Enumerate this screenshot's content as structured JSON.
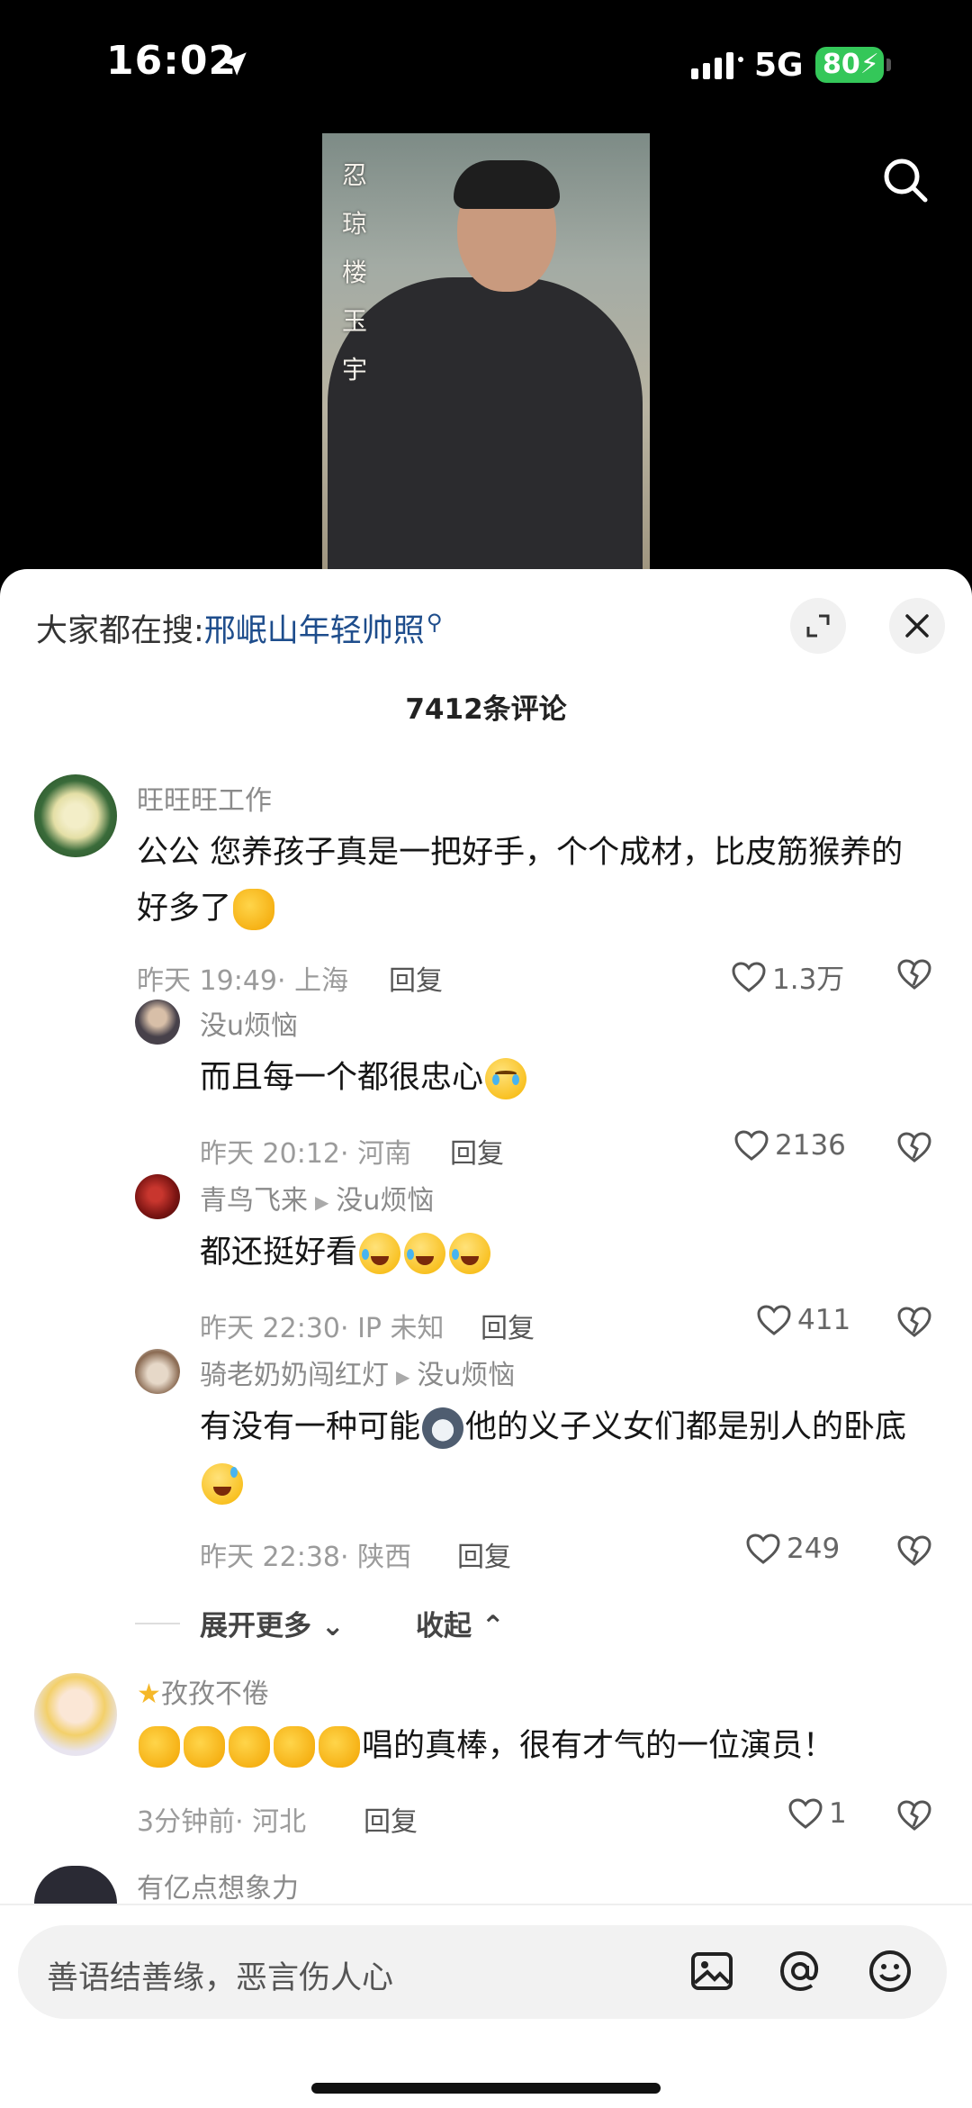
{
  "status_bar": {
    "time": "16:02",
    "network": "5G",
    "battery": "80"
  },
  "video": {
    "overlay_text": "忍 琼 楼 玉 宇"
  },
  "sheet": {
    "hot_search_label": "大家都在搜:",
    "hot_search_keyword": "邢岷山年轻帅照",
    "comment_count": "7412条评论",
    "expand_more": "展开更多",
    "collapse": "收起",
    "input_placeholder": "善语结善缘，恶言伤人心"
  },
  "comments": [
    {
      "name": "旺旺旺工作",
      "text": "公公 您养孩子真是一把好手，个个成材，比皮筋猴养的好多了",
      "time": "昨天 19:49",
      "location": "· 上海",
      "reply": "回复",
      "likes": "1.3万"
    },
    {
      "name": "没u烦恼",
      "text": "而且每一个都很忠心",
      "time": "昨天 20:12",
      "location": "· 河南",
      "reply": "回复",
      "likes": "2136"
    },
    {
      "name": "青鸟飞来",
      "reply_to": "没u烦恼",
      "text": "都还挺好看",
      "time": "昨天 22:30",
      "location": "· IP 未知",
      "reply": "回复",
      "likes": "411"
    },
    {
      "name": "骑老奶奶闯红灯",
      "reply_to": "没u烦恼",
      "text_a": "有没有一种可能",
      "text_b": "他的义子义女们都是别人的卧底",
      "time": "昨天 22:38",
      "location": "· 陕西",
      "reply": "回复",
      "likes": "249"
    },
    {
      "name": "孜孜不倦",
      "text": "唱的真棒，很有才气的一位演员！",
      "time": "3分钟前",
      "location": "· 河北",
      "reply": "回复",
      "likes": "1"
    },
    {
      "name": "有亿点想象力"
    }
  ],
  "icons": {
    "location": "location-arrow-icon",
    "search": "search-icon",
    "expand": "expand-icon",
    "close": "close-icon",
    "like": "heart-icon",
    "dislike": "broken-heart-icon",
    "image": "image-icon",
    "mention": "at-icon",
    "emoji": "smiley-icon"
  }
}
